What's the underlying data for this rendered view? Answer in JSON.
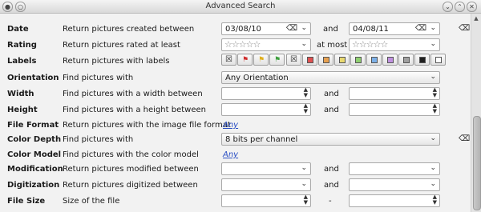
{
  "window": {
    "title": "Advanced Search"
  },
  "rows": {
    "date": {
      "label": "Date",
      "desc": "Return pictures created between",
      "from": "03/08/10",
      "and": "and",
      "to": "04/08/11"
    },
    "rating": {
      "label": "Rating",
      "desc": "Return pictures rated at least",
      "at_most": "at most",
      "stars": "☆☆☆☆☆"
    },
    "labels": {
      "label": "Labels",
      "desc": "Return pictures with labels",
      "flags": [
        "none",
        "red",
        "yellow",
        "green"
      ],
      "colors": [
        "#ffffff",
        "#e05050",
        "#e6a050",
        "#e8d870",
        "#8fd070",
        "#7cb0e8",
        "#c090e0",
        "#a0a0a0",
        "#202020",
        "#ffffff"
      ]
    },
    "orientation": {
      "label": "Orientation",
      "desc": "Find pictures with",
      "value": "Any Orientation"
    },
    "width": {
      "label": "Width",
      "desc": "Find pictures with a width between",
      "and": "and"
    },
    "height": {
      "label": "Height",
      "desc": "Find pictures with a height between",
      "and": "and"
    },
    "file_format": {
      "label": "File Format",
      "desc": "Return pictures with the image file format",
      "link": "Any"
    },
    "color_depth": {
      "label": "Color Depth",
      "desc": "Find pictures with",
      "value": "8 bits per channel"
    },
    "color_model": {
      "label": "Color Model",
      "desc": "Find pictures with the color model",
      "link": "Any"
    },
    "modification": {
      "label": "Modification",
      "desc": "Return pictures modified between",
      "and": "and"
    },
    "digitization": {
      "label": "Digitization",
      "desc": "Return pictures digitized between",
      "and": "and"
    },
    "file_size": {
      "label": "File Size",
      "desc": "Size of the file",
      "sep": "-"
    }
  }
}
